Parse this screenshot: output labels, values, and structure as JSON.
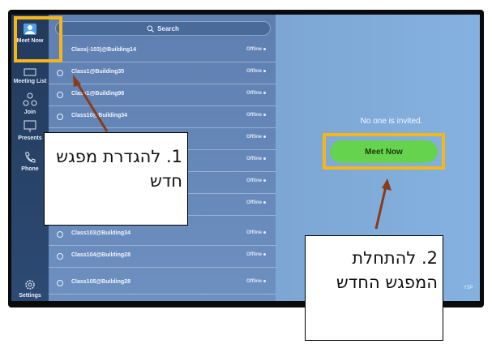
{
  "sidebar": {
    "items": [
      {
        "label": "Meet Now",
        "icon": "person-icon"
      },
      {
        "label": "Meeting List",
        "icon": "list-icon"
      },
      {
        "label": "Join",
        "icon": "join-icon"
      },
      {
        "label": "Presents",
        "icon": "presentation-icon"
      },
      {
        "label": "Phone",
        "icon": "phone-icon"
      },
      {
        "label": "Settings",
        "icon": "gear-icon"
      }
    ]
  },
  "search": {
    "placeholder": "Search"
  },
  "contacts": [
    {
      "name": "Class(-103)@Building14",
      "status": "Offline"
    },
    {
      "name": "Class1@Building35",
      "status": "Offline"
    },
    {
      "name": "Class1@Building98",
      "status": "Offline"
    },
    {
      "name": "Class10@Building34",
      "status": "Offline"
    },
    {
      "name": "",
      "status": "Offline"
    },
    {
      "name": "",
      "status": "Offline"
    },
    {
      "name": "",
      "status": "Offline"
    },
    {
      "name": "",
      "status": "Offline"
    },
    {
      "name": "Class103@Building34",
      "status": "Offline"
    },
    {
      "name": "Class104@Building28",
      "status": "Offline"
    },
    {
      "name": "Class105@Building28",
      "status": "Offline"
    }
  ],
  "main": {
    "invite_text": "No one is invited.",
    "meet_now_button": "Meet Now",
    "corner_label": "Y3P"
  },
  "annotations": {
    "callout1": "1. להגדרת מפגש חדש",
    "callout2": "2. להתחלת המפגש החדש",
    "highlight_color": "#f5b61b",
    "arrow_color": "#8b3a1a"
  }
}
